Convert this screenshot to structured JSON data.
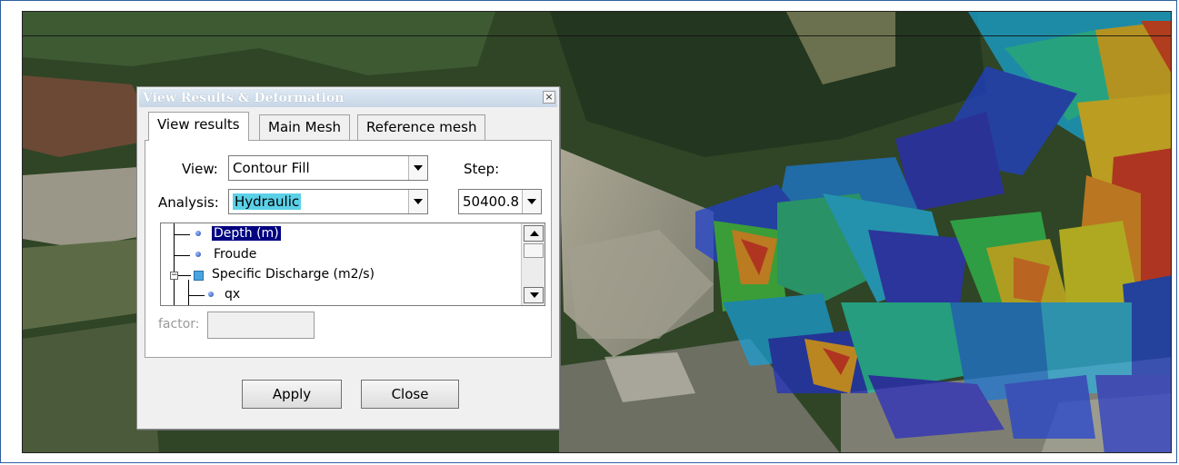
{
  "dialog": {
    "title": "View Results & Deformation",
    "close_glyph": "×"
  },
  "tabs": [
    {
      "label": "View results",
      "active": true
    },
    {
      "label": "Main Mesh",
      "active": false
    },
    {
      "label": "Reference mesh",
      "active": false
    }
  ],
  "view": {
    "label": "View:",
    "value": "Contour Fill"
  },
  "step": {
    "label": "Step:",
    "value": "50400.8"
  },
  "analysis": {
    "label": "Analysis:",
    "value": "Hydraulic"
  },
  "tree": {
    "items": [
      {
        "label": "Depth (m)",
        "selected": true
      },
      {
        "label": "Froude",
        "selected": false
      },
      {
        "label": "Specific Discharge (m2/s)",
        "selected": false
      },
      {
        "label": "qx",
        "selected": false
      }
    ]
  },
  "factor": {
    "label": "factor:",
    "value": ""
  },
  "buttons": {
    "apply": "Apply",
    "close": "Close"
  },
  "colors": {
    "selection": "#000080",
    "highlight": "#5bd1e8",
    "frame": "#2f5f9e"
  }
}
